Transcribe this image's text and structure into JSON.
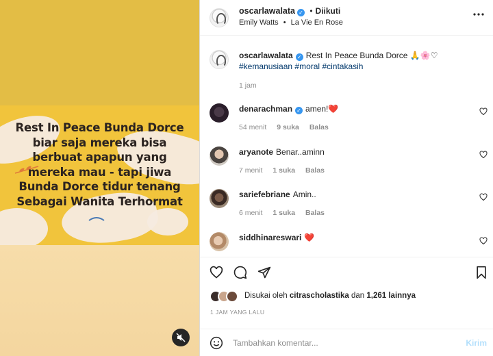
{
  "media": {
    "quote_lines": [
      "Rest In Peace Bunda Dorce",
      "biar saja mereka bisa",
      "berbuat apapun yang",
      "mereka mau - tapi jiwa",
      "Bunda Dorce tidur tenang",
      "Sebagai Wanita Terhormat"
    ]
  },
  "header": {
    "username": "oscarlawalata",
    "separator": "•",
    "follow_status": "Diikuti",
    "audio_artist": "Emily Watts",
    "audio_separator": "•",
    "audio_title": "La Vie En Rose"
  },
  "caption": {
    "username": "oscarlawalata",
    "text": "Rest In Peace Bunda Dorce",
    "emojis": "🙏🌸♡",
    "hashtags": [
      "#kemanusiaan",
      "#moral",
      "#cintakasih"
    ],
    "time": "1 jam"
  },
  "comments": [
    {
      "username": "denarachman",
      "verified": true,
      "text": "amen!",
      "emoji": "❤️",
      "time": "54 menit",
      "likes": "9 suka",
      "reply": "Balas"
    },
    {
      "username": "aryanote",
      "verified": false,
      "text": "Benar..aminn",
      "emoji": "",
      "time": "7 menit",
      "likes": "1 suka",
      "reply": "Balas"
    },
    {
      "username": "sariefebriane",
      "verified": false,
      "text": "Amin..",
      "emoji": "",
      "time": "6 menit",
      "likes": "1 suka",
      "reply": "Balas"
    },
    {
      "username": "siddhinareswari",
      "verified": false,
      "text": "",
      "emoji": "❤️",
      "time": "",
      "likes": "",
      "reply": ""
    }
  ],
  "likes": {
    "prefix": "Disukai oleh",
    "user": "citrascholastika",
    "conj": "dan",
    "others": "1,261 lainnya"
  },
  "time_ago": "1 JAM YANG LALU",
  "comment_box": {
    "placeholder": "Tambahkan komentar...",
    "send_label": "Kirim"
  },
  "colors": {
    "verified": "#3897f0",
    "hashtag": "#00376b",
    "heart": "#ed4956",
    "send_disabled": "#b2dffc"
  }
}
